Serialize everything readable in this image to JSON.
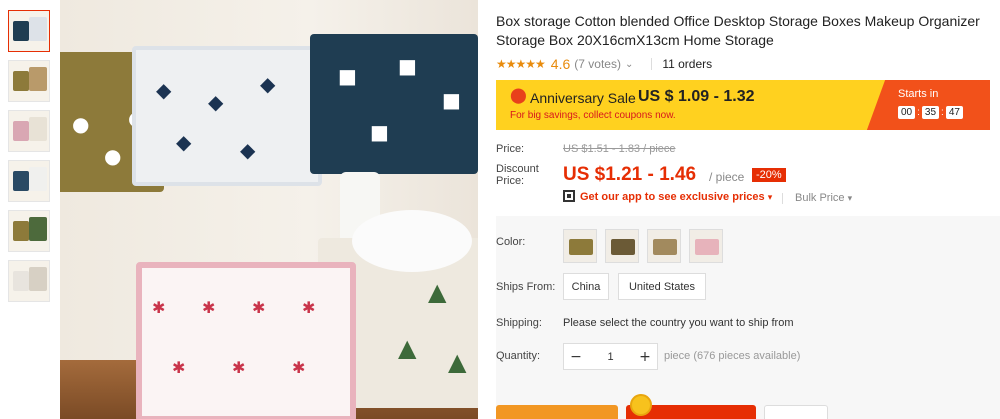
{
  "product": {
    "title": "Box storage Cotton blended Office Desktop Storage Boxes Makeup Organizer Storage Box 20X16cmX13cm Home Storage",
    "stars": "★★★★★",
    "rating_value": "4.6",
    "votes": "(7 votes)",
    "orders": "11 orders"
  },
  "banner": {
    "sale_name": "Anniversary Sale",
    "sale_price": "US $ 1.09 - 1.32",
    "subtext": "For big savings, collect coupons now.",
    "starts_label": "Starts in",
    "timer": {
      "h": "00",
      "m": "35",
      "s": "47"
    },
    "colors": {
      "bg": "#ffd11f",
      "accent": "#f2511a"
    }
  },
  "price": {
    "label": "Price:",
    "original": "US $1.51 - 1.83 / piece",
    "discount_label_1": "Discount",
    "discount_label_2": "Price:",
    "discount": "US $1.21 - 1.46",
    "unit": "/ piece",
    "badge": "-20%"
  },
  "app_promo": "Get our app to see exclusive prices",
  "bulk_price": "Bulk Price",
  "options": {
    "color_label": "Color:",
    "swatches": [
      "olive",
      "whale",
      "tree",
      "snow"
    ],
    "ships_from_label": "Ships From:",
    "ships_from": [
      "China",
      "United States"
    ],
    "shipping_label": "Shipping:",
    "shipping_msg": "Please select the country you want to ship from",
    "quantity_label": "Quantity:",
    "quantity": "1",
    "availability": "piece (676 pieces available)"
  },
  "icons": {
    "pin": "location-pin-icon",
    "chevron": "chevron-down-icon",
    "qr": "qr-code-icon",
    "minus": "minus-icon",
    "plus": "plus-icon"
  },
  "colors": {
    "brand_red": "#e62e04",
    "star_orange": "#e88b0d"
  }
}
